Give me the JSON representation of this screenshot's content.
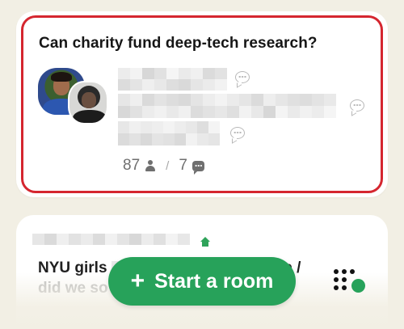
{
  "rooms": [
    {
      "title": "Can charity fund deep-tech research?",
      "listener_count": "87",
      "speaker_count": "7"
    },
    {
      "title_visible": "NYU girls",
      "title_tail": "recap /",
      "title_line2": "did we so"
    }
  ],
  "start_button": {
    "plus": "+",
    "label": "Start a room"
  },
  "icons": {
    "person": "person-icon",
    "chat": "chat-bubble-icon",
    "house": "house-icon",
    "grid": "dots-grid-icon"
  },
  "colors": {
    "background": "#f2efe4",
    "accent_green": "#27a25a",
    "highlight_red": "#d5262f"
  }
}
